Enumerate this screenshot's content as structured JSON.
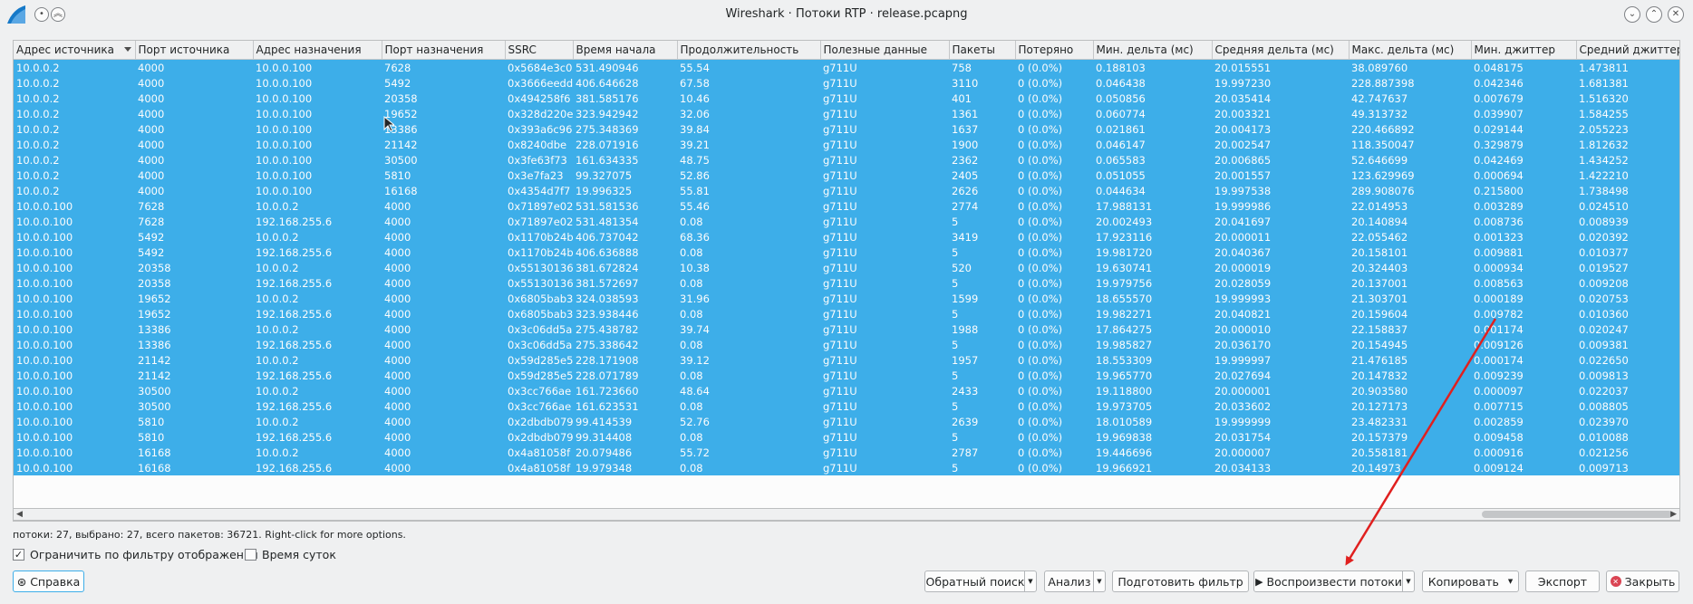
{
  "window": {
    "title": "Wireshark · Потоки RTP · release.pcapng"
  },
  "table": {
    "columns": [
      "Адрес источника",
      "Порт источника",
      "Адрес назначения",
      "Порт назначения",
      "SSRC",
      "Время начала",
      "Продолжительность",
      "Полезные данные",
      "Пакеты",
      "Потеряно",
      "Мин. дельта (мс)",
      "Средняя дельта (мс)",
      "Макс. дельта (мс)",
      "Мин. джиттер",
      "Средний джиттер"
    ],
    "rows": [
      [
        "10.0.0.2",
        "4000",
        "10.0.0.100",
        "7628",
        "0x5684e3c0",
        "531.490946",
        "55.54",
        "g711U",
        "758",
        "0 (0.0%)",
        "0.188103",
        "20.015551",
        "38.089760",
        "0.048175",
        "1.473811"
      ],
      [
        "10.0.0.2",
        "4000",
        "10.0.0.100",
        "5492",
        "0x3666eedd",
        "406.646628",
        "67.58",
        "g711U",
        "3110",
        "0 (0.0%)",
        "0.046438",
        "19.997230",
        "228.887398",
        "0.042346",
        "1.681381"
      ],
      [
        "10.0.0.2",
        "4000",
        "10.0.0.100",
        "20358",
        "0x494258f6",
        "381.585176",
        "10.46",
        "g711U",
        "401",
        "0 (0.0%)",
        "0.050856",
        "20.035414",
        "42.747637",
        "0.007679",
        "1.516320"
      ],
      [
        "10.0.0.2",
        "4000",
        "10.0.0.100",
        "19652",
        "0x328d220e",
        "323.942942",
        "32.06",
        "g711U",
        "1361",
        "0 (0.0%)",
        "0.060774",
        "20.003321",
        "49.313732",
        "0.039907",
        "1.584255"
      ],
      [
        "10.0.0.2",
        "4000",
        "10.0.0.100",
        "13386",
        "0x393a6c96",
        "275.348369",
        "39.84",
        "g711U",
        "1637",
        "0 (0.0%)",
        "0.021861",
        "20.004173",
        "220.466892",
        "0.029144",
        "2.055223"
      ],
      [
        "10.0.0.2",
        "4000",
        "10.0.0.100",
        "21142",
        "0x8240dbe",
        "228.071916",
        "39.21",
        "g711U",
        "1900",
        "0 (0.0%)",
        "0.046147",
        "20.002547",
        "118.350047",
        "0.329879",
        "1.812632"
      ],
      [
        "10.0.0.2",
        "4000",
        "10.0.0.100",
        "30500",
        "0x3fe63f73",
        "161.634335",
        "48.75",
        "g711U",
        "2362",
        "0 (0.0%)",
        "0.065583",
        "20.006865",
        "52.646699",
        "0.042469",
        "1.434252"
      ],
      [
        "10.0.0.2",
        "4000",
        "10.0.0.100",
        "5810",
        "0x3e7fa23",
        "99.327075",
        "52.86",
        "g711U",
        "2405",
        "0 (0.0%)",
        "0.051055",
        "20.001557",
        "123.629969",
        "0.000694",
        "1.422210"
      ],
      [
        "10.0.0.2",
        "4000",
        "10.0.0.100",
        "16168",
        "0x4354d7f7",
        "19.996325",
        "55.81",
        "g711U",
        "2626",
        "0 (0.0%)",
        "0.044634",
        "19.997538",
        "289.908076",
        "0.215800",
        "1.738498"
      ],
      [
        "10.0.0.100",
        "7628",
        "10.0.0.2",
        "4000",
        "0x71897e02",
        "531.581536",
        "55.46",
        "g711U",
        "2774",
        "0 (0.0%)",
        "17.988131",
        "19.999986",
        "22.014953",
        "0.003289",
        "0.024510"
      ],
      [
        "10.0.0.100",
        "7628",
        "192.168.255.6",
        "4000",
        "0x71897e02",
        "531.481354",
        "0.08",
        "g711U",
        "5",
        "0 (0.0%)",
        "20.002493",
        "20.041697",
        "20.140894",
        "0.008736",
        "0.008939"
      ],
      [
        "10.0.0.100",
        "5492",
        "10.0.0.2",
        "4000",
        "0x1170b24b",
        "406.737042",
        "68.36",
        "g711U",
        "3419",
        "0 (0.0%)",
        "17.923116",
        "20.000011",
        "22.055462",
        "0.001323",
        "0.020392"
      ],
      [
        "10.0.0.100",
        "5492",
        "192.168.255.6",
        "4000",
        "0x1170b24b",
        "406.636888",
        "0.08",
        "g711U",
        "5",
        "0 (0.0%)",
        "19.981720",
        "20.040367",
        "20.158101",
        "0.009881",
        "0.010377"
      ],
      [
        "10.0.0.100",
        "20358",
        "10.0.0.2",
        "4000",
        "0x55130136",
        "381.672824",
        "10.38",
        "g711U",
        "520",
        "0 (0.0%)",
        "19.630741",
        "20.000019",
        "20.324403",
        "0.000934",
        "0.019527"
      ],
      [
        "10.0.0.100",
        "20358",
        "192.168.255.6",
        "4000",
        "0x55130136",
        "381.572697",
        "0.08",
        "g711U",
        "5",
        "0 (0.0%)",
        "19.979756",
        "20.028059",
        "20.137001",
        "0.008563",
        "0.009208"
      ],
      [
        "10.0.0.100",
        "19652",
        "10.0.0.2",
        "4000",
        "0x6805bab3",
        "324.038593",
        "31.96",
        "g711U",
        "1599",
        "0 (0.0%)",
        "18.655570",
        "19.999993",
        "21.303701",
        "0.000189",
        "0.020753"
      ],
      [
        "10.0.0.100",
        "19652",
        "192.168.255.6",
        "4000",
        "0x6805bab3",
        "323.938446",
        "0.08",
        "g711U",
        "5",
        "0 (0.0%)",
        "19.982271",
        "20.040821",
        "20.159604",
        "0.009782",
        "0.010360"
      ],
      [
        "10.0.0.100",
        "13386",
        "10.0.0.2",
        "4000",
        "0x3c06dd5a",
        "275.438782",
        "39.74",
        "g711U",
        "1988",
        "0 (0.0%)",
        "17.864275",
        "20.000010",
        "22.158837",
        "0.001174",
        "0.020247"
      ],
      [
        "10.0.0.100",
        "13386",
        "192.168.255.6",
        "4000",
        "0x3c06dd5a",
        "275.338642",
        "0.08",
        "g711U",
        "5",
        "0 (0.0%)",
        "19.985827",
        "20.036170",
        "20.154945",
        "0.009126",
        "0.009381"
      ],
      [
        "10.0.0.100",
        "21142",
        "10.0.0.2",
        "4000",
        "0x59d285e5",
        "228.171908",
        "39.12",
        "g711U",
        "1957",
        "0 (0.0%)",
        "18.553309",
        "19.999997",
        "21.476185",
        "0.000174",
        "0.022650"
      ],
      [
        "10.0.0.100",
        "21142",
        "192.168.255.6",
        "4000",
        "0x59d285e5",
        "228.071789",
        "0.08",
        "g711U",
        "5",
        "0 (0.0%)",
        "19.965770",
        "20.027694",
        "20.147832",
        "0.009239",
        "0.009813"
      ],
      [
        "10.0.0.100",
        "30500",
        "10.0.0.2",
        "4000",
        "0x3cc766ae",
        "161.723660",
        "48.64",
        "g711U",
        "2433",
        "0 (0.0%)",
        "19.118800",
        "20.000001",
        "20.903580",
        "0.000097",
        "0.022037"
      ],
      [
        "10.0.0.100",
        "30500",
        "192.168.255.6",
        "4000",
        "0x3cc766ae",
        "161.623531",
        "0.08",
        "g711U",
        "5",
        "0 (0.0%)",
        "19.973705",
        "20.033602",
        "20.127173",
        "0.007715",
        "0.008805"
      ],
      [
        "10.0.0.100",
        "5810",
        "10.0.0.2",
        "4000",
        "0x2dbdb079",
        "99.414539",
        "52.76",
        "g711U",
        "2639",
        "0 (0.0%)",
        "18.010589",
        "19.999999",
        "23.482331",
        "0.002859",
        "0.023970"
      ],
      [
        "10.0.0.100",
        "5810",
        "192.168.255.6",
        "4000",
        "0x2dbdb079",
        "99.314408",
        "0.08",
        "g711U",
        "5",
        "0 (0.0%)",
        "19.969838",
        "20.031754",
        "20.157379",
        "0.009458",
        "0.010088"
      ],
      [
        "10.0.0.100",
        "16168",
        "10.0.0.2",
        "4000",
        "0x4a81058f",
        "20.079486",
        "55.72",
        "g711U",
        "2787",
        "0 (0.0%)",
        "19.446696",
        "20.000007",
        "20.558181",
        "0.000916",
        "0.021256"
      ],
      [
        "10.0.0.100",
        "16168",
        "192.168.255.6",
        "4000",
        "0x4a81058f",
        "19.979348",
        "0.08",
        "g711U",
        "5",
        "0 (0.0%)",
        "19.966921",
        "20.034133",
        "20.14973",
        "0.009124",
        "0.009713"
      ]
    ]
  },
  "status": "потоки: 27, выбрано: 27, всего пакетов: 36721. Right-click for more options.",
  "options": {
    "limit_filter": "Ограничить по фильтру отображения",
    "time_of_day": "Время суток"
  },
  "buttons": {
    "help": "Справка",
    "reverse_search": "Обратный поиск",
    "analyze": "Анализ",
    "prepare_filter": "Подготовить фильтр",
    "play_streams": "Воспроизвести потоки",
    "copy": "Копировать",
    "export": "Экспорт",
    "close": "Закрыть"
  },
  "colors": {
    "selection": "#3daee9",
    "annotation_arrow": "#e0201f"
  }
}
